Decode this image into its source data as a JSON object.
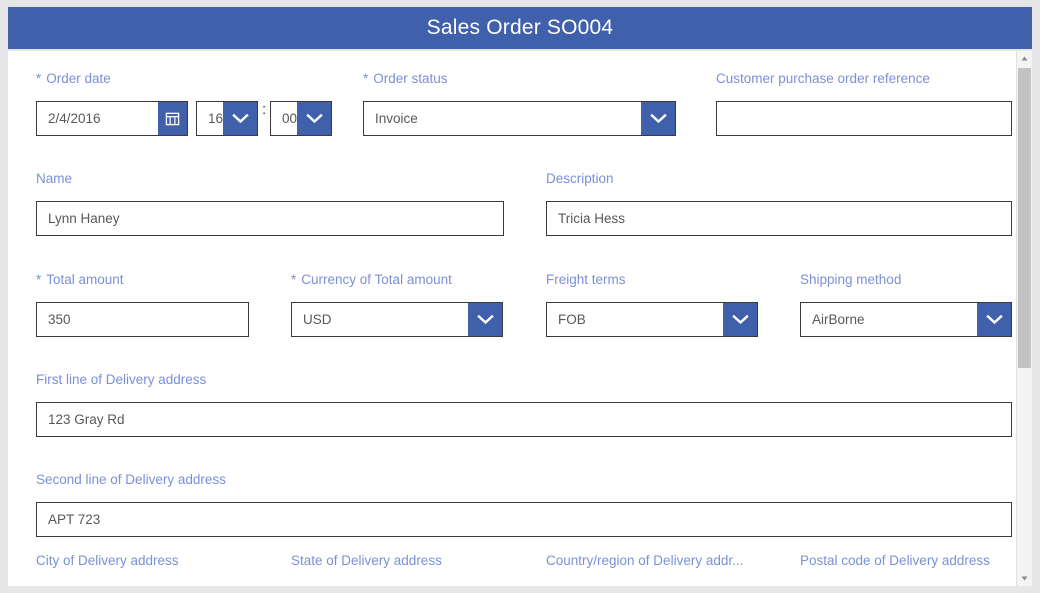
{
  "window": {
    "title": "Sales Order SO004"
  },
  "theme": {
    "header_bg": "#4060ab",
    "label_color": "#7b90d6",
    "accent": "#4060ab",
    "input_border": "#3a3a3a",
    "value_color": "#585858",
    "page_bg": "#e6e6e6"
  },
  "form": {
    "rows": [
      {
        "fields": [
          {
            "name": "order-date",
            "label": "Order date",
            "required": true,
            "type": "date",
            "value": "2/4/2016",
            "icon": "calendar-icon"
          },
          {
            "name": "order-hour",
            "label": "",
            "required": false,
            "type": "select",
            "value": "16",
            "icon": "chevron-down-icon"
          },
          {
            "name": "order-minute",
            "label": "",
            "required": false,
            "type": "select",
            "value": "00",
            "icon": "chevron-down-icon"
          },
          {
            "name": "order-status",
            "label": "Order status",
            "required": true,
            "type": "select",
            "value": "Invoice",
            "icon": "chevron-down-icon"
          },
          {
            "name": "customer-purchase-order-reference",
            "label": "Customer purchase order reference",
            "required": false,
            "type": "text",
            "value": ""
          }
        ]
      },
      {
        "fields": [
          {
            "name": "name",
            "label": "Name",
            "required": false,
            "type": "text",
            "value": "Lynn Haney"
          },
          {
            "name": "description",
            "label": "Description",
            "required": false,
            "type": "text",
            "value": "Tricia Hess"
          }
        ]
      },
      {
        "fields": [
          {
            "name": "total-amount",
            "label": "Total amount",
            "required": true,
            "type": "text",
            "value": "350"
          },
          {
            "name": "currency-of-total-amount",
            "label": "Currency of Total amount",
            "required": true,
            "type": "select",
            "value": "USD",
            "icon": "chevron-down-icon"
          },
          {
            "name": "freight-terms",
            "label": "Freight terms",
            "required": false,
            "type": "select",
            "value": "FOB",
            "icon": "chevron-down-icon"
          },
          {
            "name": "shipping-method",
            "label": "Shipping method",
            "required": false,
            "type": "select",
            "value": "AirBorne",
            "icon": "chevron-down-icon"
          }
        ]
      },
      {
        "fields": [
          {
            "name": "first-line-of-delivery-address",
            "label": "First line of Delivery address",
            "required": false,
            "type": "text",
            "value": "123 Gray Rd"
          }
        ]
      },
      {
        "fields": [
          {
            "name": "second-line-of-delivery-address",
            "label": "Second line of Delivery address",
            "required": false,
            "type": "text",
            "value": "APT 723"
          }
        ]
      }
    ],
    "partial_labels": [
      "City of Delivery address",
      "State of Delivery address",
      "Country/region of Delivery addr...",
      "Postal code of Delivery address"
    ]
  },
  "scrollbar": {
    "up_arrow": "scroll-up-arrow",
    "down_arrow": "scroll-down-arrow",
    "thumb": "scroll-thumb"
  }
}
